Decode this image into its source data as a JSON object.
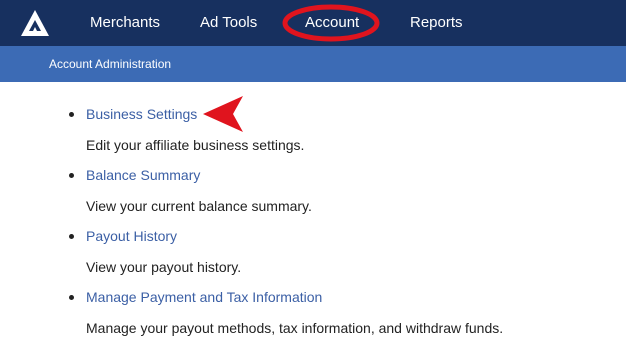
{
  "app": {
    "logo_icon": "triangle-logo-icon",
    "brand_color": "#17305f",
    "subnav_color": "#3c6bb5",
    "link_color": "#3b5fa5",
    "annotation_color": "#e0141e"
  },
  "nav": {
    "items": [
      {
        "label": "Merchants"
      },
      {
        "label": "Ad Tools"
      },
      {
        "label": "Account",
        "active": true
      },
      {
        "label": "Reports"
      }
    ]
  },
  "subnav": {
    "items": [
      {
        "label": "Account Administration"
      }
    ]
  },
  "content": {
    "items": [
      {
        "title": "Business Settings",
        "description": "Edit your affiliate business settings."
      },
      {
        "title": "Balance Summary",
        "description": "View your current balance summary."
      },
      {
        "title": "Payout History",
        "description": "View your payout history."
      },
      {
        "title": "Manage Payment and Tax Information",
        "description": "Manage your payout methods, tax information, and withdraw funds."
      }
    ]
  }
}
